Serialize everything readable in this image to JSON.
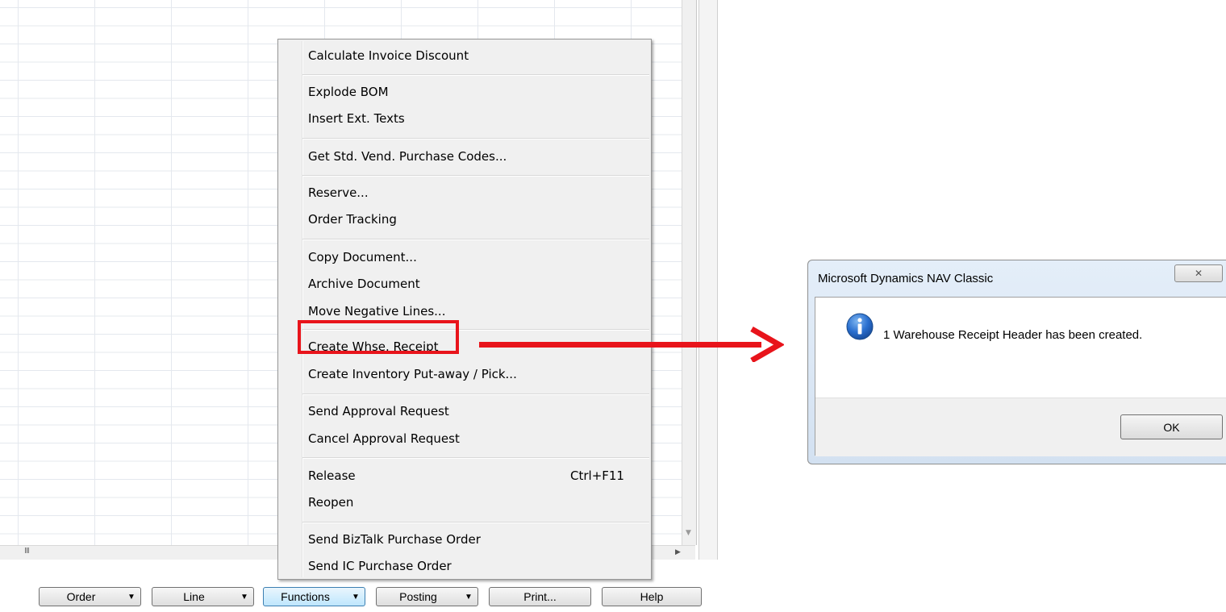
{
  "toolbar": {
    "buttons": [
      {
        "label": "Order",
        "has_dropdown": true
      },
      {
        "label": "Line",
        "has_dropdown": true
      },
      {
        "label": "Functions",
        "has_dropdown": true,
        "active": true
      },
      {
        "label": "Posting",
        "has_dropdown": true
      },
      {
        "label": "Print...",
        "has_dropdown": false
      },
      {
        "label": "Help",
        "has_dropdown": false
      }
    ]
  },
  "functions_menu": {
    "items": [
      {
        "label": "Calculate Invoice Discount"
      },
      {
        "label": "Explode BOM"
      },
      {
        "label": "Insert Ext. Texts"
      },
      {
        "label": "Get Std. Vend. Purchase Codes..."
      },
      {
        "label": "Reserve..."
      },
      {
        "label": "Order Tracking"
      },
      {
        "label": "Copy Document..."
      },
      {
        "label": "Archive Document"
      },
      {
        "label": "Move Negative Lines..."
      },
      {
        "label": "Create Whse. Receipt",
        "highlighted": true
      },
      {
        "label": "Create Inventory Put-away / Pick..."
      },
      {
        "label": "Send Approval Request"
      },
      {
        "label": "Cancel Approval Request"
      },
      {
        "label": "Release",
        "shortcut": "Ctrl+F11"
      },
      {
        "label": "Reopen"
      },
      {
        "label": "Send BizTalk Purchase Order"
      },
      {
        "label": "Send IC Purchase Order"
      }
    ]
  },
  "scrollbar": {
    "grip": "III"
  },
  "dialog": {
    "title": "Microsoft Dynamics NAV Classic",
    "close_glyph": "✕",
    "message": "1 Warehouse Receipt Header has been created.",
    "ok_label": "OK",
    "icon": "info-icon"
  },
  "colors": {
    "highlight": "#e8141b",
    "accent_blue": "#3c7fb1"
  }
}
